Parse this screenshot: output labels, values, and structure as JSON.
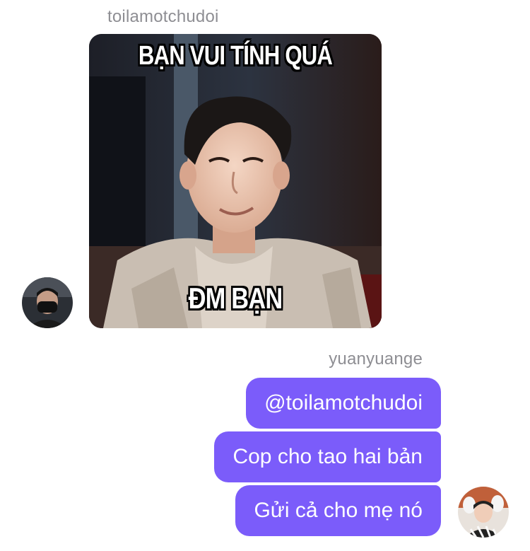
{
  "messages": {
    "incoming": {
      "sender": "toilamotchudoi",
      "meme": {
        "caption_top": "BẠN VUI TÍNH QUÁ",
        "caption_bottom": "ĐM BẠN"
      }
    },
    "outgoing": {
      "sender": "yuanyuange",
      "bubbles": [
        {
          "text": "@toilamotchudoi"
        },
        {
          "text": "Cop cho tao hai bản"
        },
        {
          "text": "Gửi cả cho mẹ nó"
        }
      ]
    }
  },
  "colors": {
    "bubble": "#7b5cfa",
    "sender_name": "#8e8e93"
  }
}
